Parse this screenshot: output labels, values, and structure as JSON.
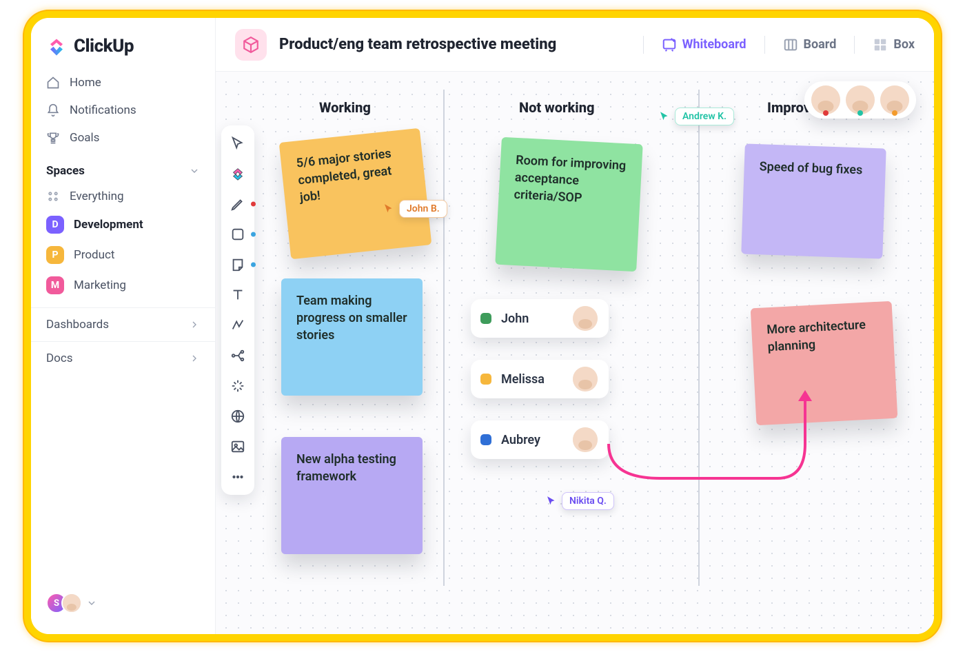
{
  "brand": {
    "name": "ClickUp"
  },
  "sidebar": {
    "nav": [
      {
        "label": "Home"
      },
      {
        "label": "Notifications"
      },
      {
        "label": "Goals"
      }
    ],
    "spaces_header": "Spaces",
    "everything": "Everything",
    "spaces": [
      {
        "letter": "D",
        "label": "Development",
        "color": "#7b61ff",
        "active": true
      },
      {
        "letter": "P",
        "label": "Product",
        "color": "#f6b73c",
        "active": false
      },
      {
        "letter": "M",
        "label": "Marketing",
        "color": "#f15a9b",
        "active": false
      }
    ],
    "sections": [
      {
        "label": "Dashboards"
      },
      {
        "label": "Docs"
      }
    ],
    "footer_avatar_initial": "S"
  },
  "header": {
    "title": "Product/eng team retrospective meeting",
    "views": [
      {
        "label": "Whiteboard",
        "active": true
      },
      {
        "label": "Board",
        "active": false
      },
      {
        "label": "Box",
        "active": false
      }
    ]
  },
  "whiteboard": {
    "columns": [
      {
        "label": "Working"
      },
      {
        "label": "Not working"
      },
      {
        "label": "Improve"
      }
    ],
    "stickies": {
      "s1": "5/6 major stories completed, great job!",
      "s2": "Team making progress on smaller stories",
      "s3": "New alpha testing framework",
      "s4": "Room for improving acceptance criteria/SOP",
      "s5": "Speed of bug fixes",
      "s6": "More architecture planning"
    },
    "cursors": {
      "john": "John B.",
      "andrew": "Andrew K.",
      "nikita": "Nikita Q."
    },
    "chips": [
      {
        "name": "John",
        "color": "#3e9c5b"
      },
      {
        "name": "Melissa",
        "color": "#f6b73c"
      },
      {
        "name": "Aubrey",
        "color": "#2f6fd6"
      }
    ],
    "presence_colors": [
      "#e03a3a",
      "#22c3a6",
      "#f39b2c"
    ]
  }
}
